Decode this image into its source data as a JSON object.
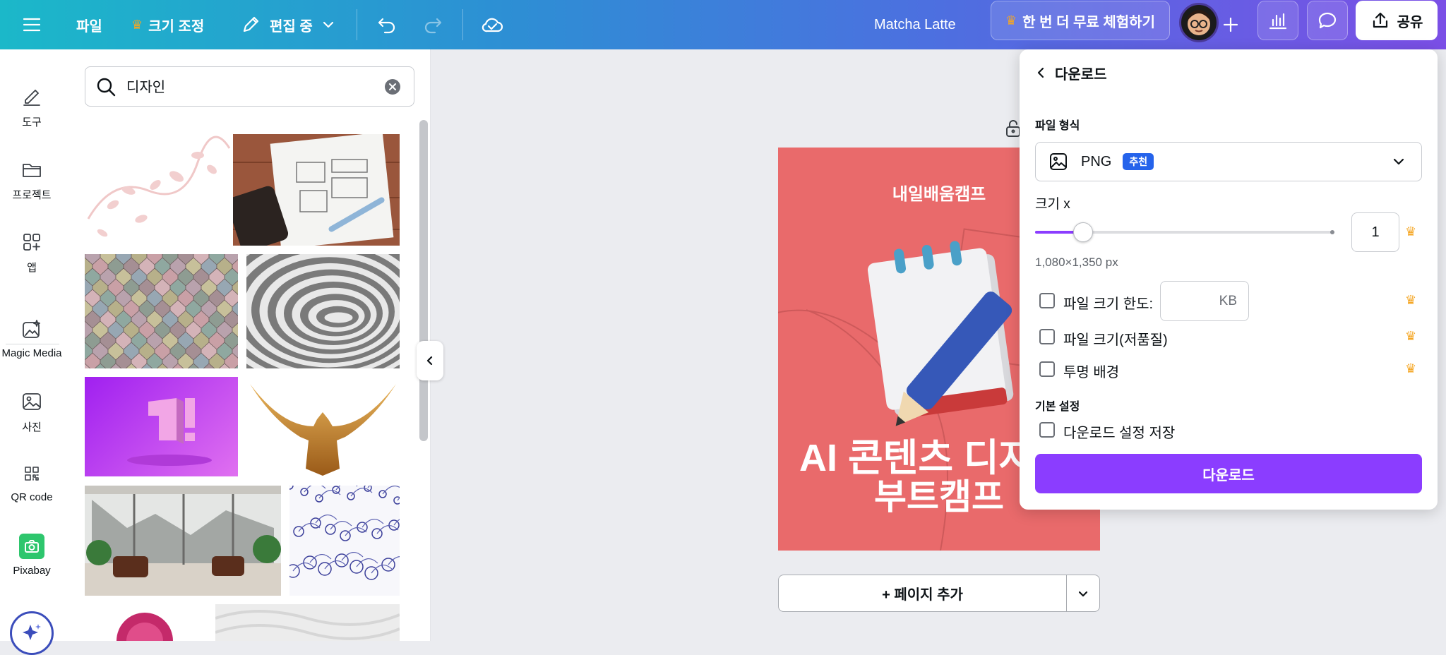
{
  "topbar": {
    "file_label": "파일",
    "resize_label": "크기 조정",
    "edit_mode_label": "편집 중",
    "doc_title": "Matcha Latte",
    "trial_label": "한 번 더 무료 체험하기",
    "share_label": "공유"
  },
  "rail": {
    "items": [
      {
        "label": "도구",
        "icon": "pen-tool-icon"
      },
      {
        "label": "프로젝트",
        "icon": "folder-icon"
      },
      {
        "label": "앱",
        "icon": "apps-grid-icon"
      },
      {
        "label": "Magic Media",
        "icon": "magic-image-icon"
      },
      {
        "label": "사진",
        "icon": "image-icon"
      },
      {
        "label": "QR code",
        "icon": "qr-code-icon"
      },
      {
        "label": "Pixabay",
        "icon": "pixabay-icon"
      }
    ]
  },
  "search": {
    "value": "디자인"
  },
  "canvas": {
    "design_top_text": "내일배움캠프",
    "design_headline_1": "AI 콘텐츠 디자인",
    "design_headline_2": "부트캠프",
    "add_page_label": "+ 페이지 추가"
  },
  "download": {
    "title": "다운로드",
    "file_type_label": "파일 형식",
    "file_type_value": "PNG",
    "recommended_badge": "추천",
    "size_label": "크기 x",
    "size_value": "1",
    "size_fraction": 0.16,
    "dimensions": "1,080×1,350 px",
    "limit_label": "파일 크기 한도:",
    "kb_unit": "KB",
    "low_quality_label": "파일 크기(저품질)",
    "transparent_label": "투명 배경",
    "preferences_label": "기본 설정",
    "save_settings_label": "다운로드 설정 저장",
    "download_button": "다운로드"
  },
  "colors": {
    "accent": "#8b3dff",
    "badge": "#2563eb",
    "crown": "#f5a623",
    "design_bg": "#e96a6b"
  }
}
